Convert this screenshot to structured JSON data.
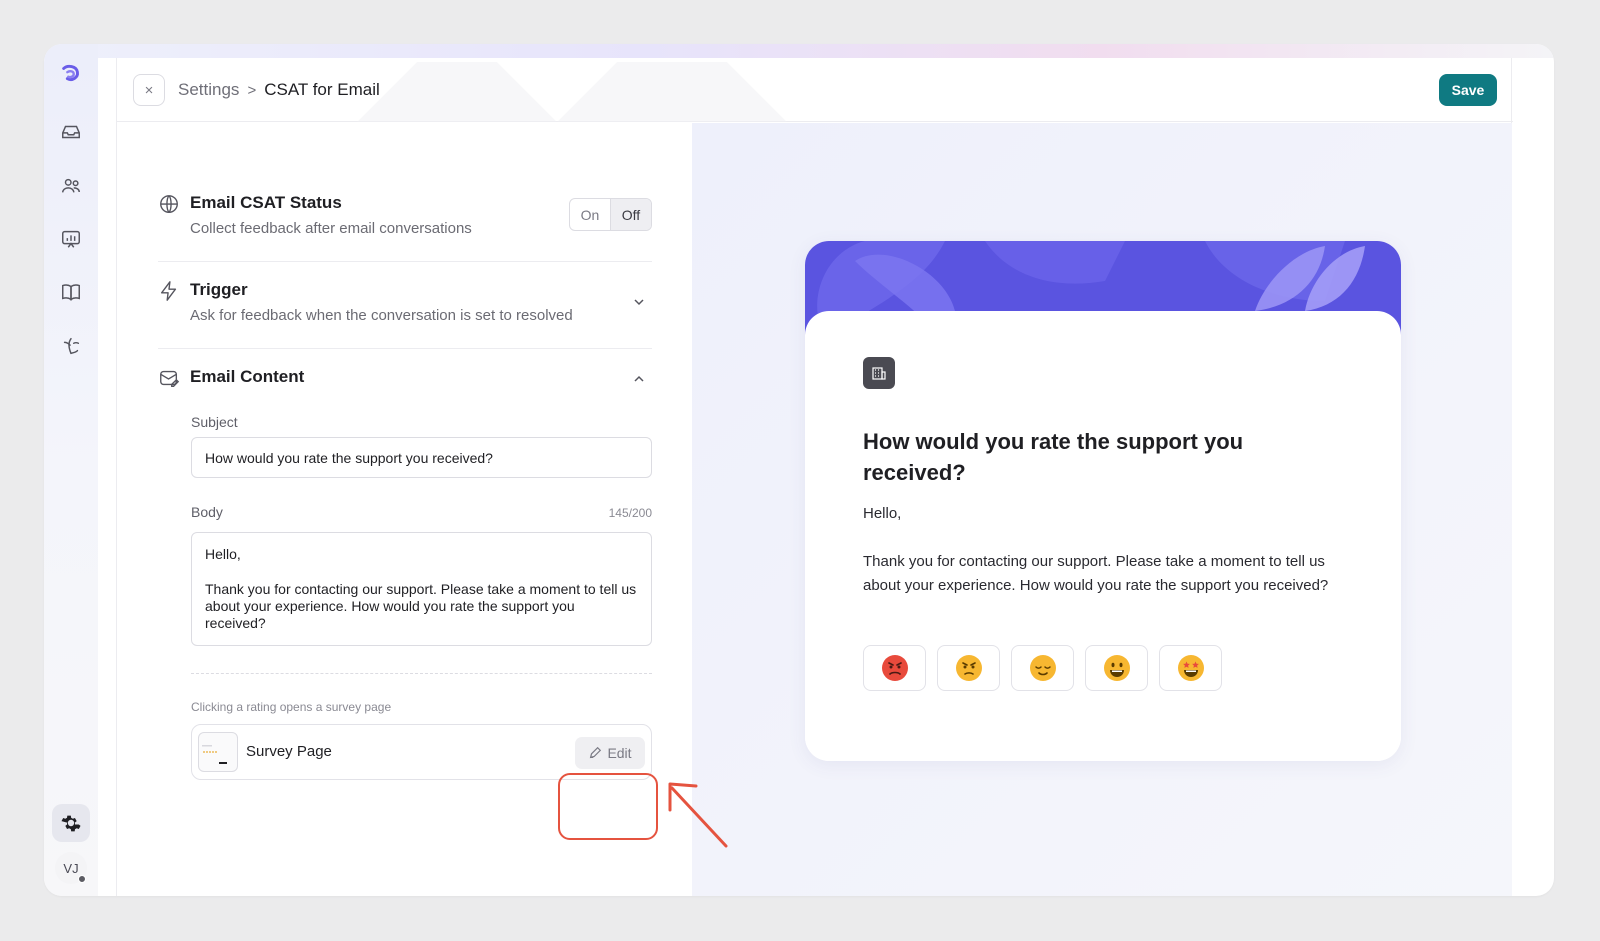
{
  "header": {
    "breadcrumb_parent": "Settings",
    "breadcrumb_separator": ">",
    "breadcrumb_current": "CSAT for Email",
    "save_label": "Save",
    "close_icon": "×"
  },
  "sidebar": {
    "items": [
      "logo-icon",
      "inbox-icon",
      "contacts-icon",
      "reports-icon",
      "knowledge-base-icon",
      "automation-icon"
    ],
    "settings_icon": "gear-icon",
    "avatar_initials": "VJ"
  },
  "csat_status": {
    "title": "Email CSAT Status",
    "description": "Collect feedback after email conversations",
    "on_label": "On",
    "off_label": "Off",
    "selected": "Off"
  },
  "trigger": {
    "title": "Trigger",
    "description": "Ask for feedback when the conversation is set to resolved"
  },
  "email_content": {
    "title": "Email Content",
    "subject_label": "Subject",
    "subject_value": "How would you rate the support you received?",
    "body_label": "Body",
    "body_counter": "145/200",
    "body_line1": "Hello,",
    "body_line2": "Thank you for contacting our support. Please take a moment to tell us about your experience. How would you rate the support you received?",
    "hint": "Clicking a rating opens a survey page",
    "survey_label": "Survey Page",
    "edit_label": "Edit"
  },
  "preview": {
    "title": "How would you rate the support you received?",
    "greeting": "Hello,",
    "body": "Thank you for contacting our support. Please take a moment to tell us about your experience. How would you rate the support you received?",
    "ratings": [
      "😡",
      "😠",
      "😌",
      "😃",
      "🤩"
    ]
  },
  "colors": {
    "accent": "#0f7a82",
    "banner": "#5a54e0",
    "highlight": "#e5533f"
  }
}
